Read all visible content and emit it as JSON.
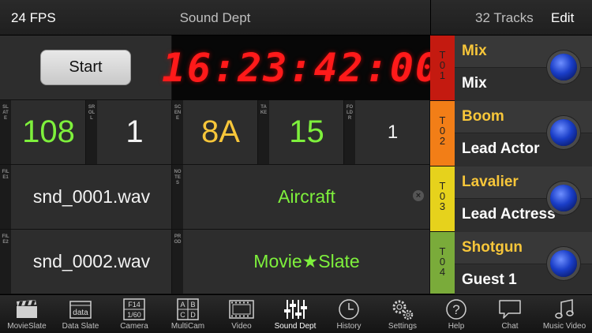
{
  "topbar": {
    "fps": "24 FPS",
    "title": "Sound Dept",
    "tracks": "32 Tracks",
    "edit": "Edit"
  },
  "controls": {
    "start": "Start",
    "timecode": "16:23:42:00"
  },
  "fields": {
    "slate": {
      "tag": "SLATE",
      "value": "108"
    },
    "sroll": {
      "tag": "SROLL",
      "value": "1"
    },
    "scene": {
      "tag": "SCENE",
      "value": "8A"
    },
    "take": {
      "tag": "TAKE",
      "value": "15"
    },
    "foldr": {
      "tag": "FOLDR",
      "value": "1"
    },
    "file1": {
      "tag": "FILE1",
      "value": "snd_0001.wav"
    },
    "notes": {
      "tag": "NOTES",
      "value": "Aircraft"
    },
    "file2": {
      "tag": "FILE2",
      "value": "snd_0002.wav"
    },
    "prod": {
      "tag": "PROD",
      "value": "Movie★Slate"
    }
  },
  "tracks": [
    {
      "id": "T\n0\n1",
      "type": "Mix",
      "name": "Mix",
      "color": "#c41a10"
    },
    {
      "id": "T\n0\n2",
      "type": "Boom",
      "name": "Lead Actor",
      "color": "#f27e17"
    },
    {
      "id": "T\n0\n3",
      "type": "Lavalier",
      "name": "Lead Actress",
      "color": "#e6d21c"
    },
    {
      "id": "T\n0\n4",
      "type": "Shotgun",
      "name": "Guest 1",
      "color": "#7aab3a"
    }
  ],
  "tabs": [
    {
      "label": "MovieSlate",
      "icon": "clapperboard-icon"
    },
    {
      "label": "Data Slate",
      "icon": "data-icon"
    },
    {
      "label": "Camera",
      "icon": "camera-settings-icon"
    },
    {
      "label": "MultiCam",
      "icon": "multicam-icon"
    },
    {
      "label": "Video",
      "icon": "film-icon"
    },
    {
      "label": "Sound Dept",
      "icon": "sliders-icon"
    },
    {
      "label": "History",
      "icon": "clock-icon"
    },
    {
      "label": "Settings",
      "icon": "gears-icon"
    },
    {
      "label": "Help",
      "icon": "help-icon"
    },
    {
      "label": "Chat",
      "icon": "chat-bubble-icon"
    },
    {
      "label": "Music Video",
      "icon": "music-note-icon"
    }
  ],
  "tab_icon_text": {
    "data": "data",
    "camera_top": "F14",
    "camera_bottom": "1/60",
    "multicam": [
      "A",
      "B",
      "C",
      "D"
    ]
  },
  "colors": {
    "green": "#7ef03c",
    "yellow": "#f7c63a",
    "clock_red": "#ff1a1a"
  }
}
